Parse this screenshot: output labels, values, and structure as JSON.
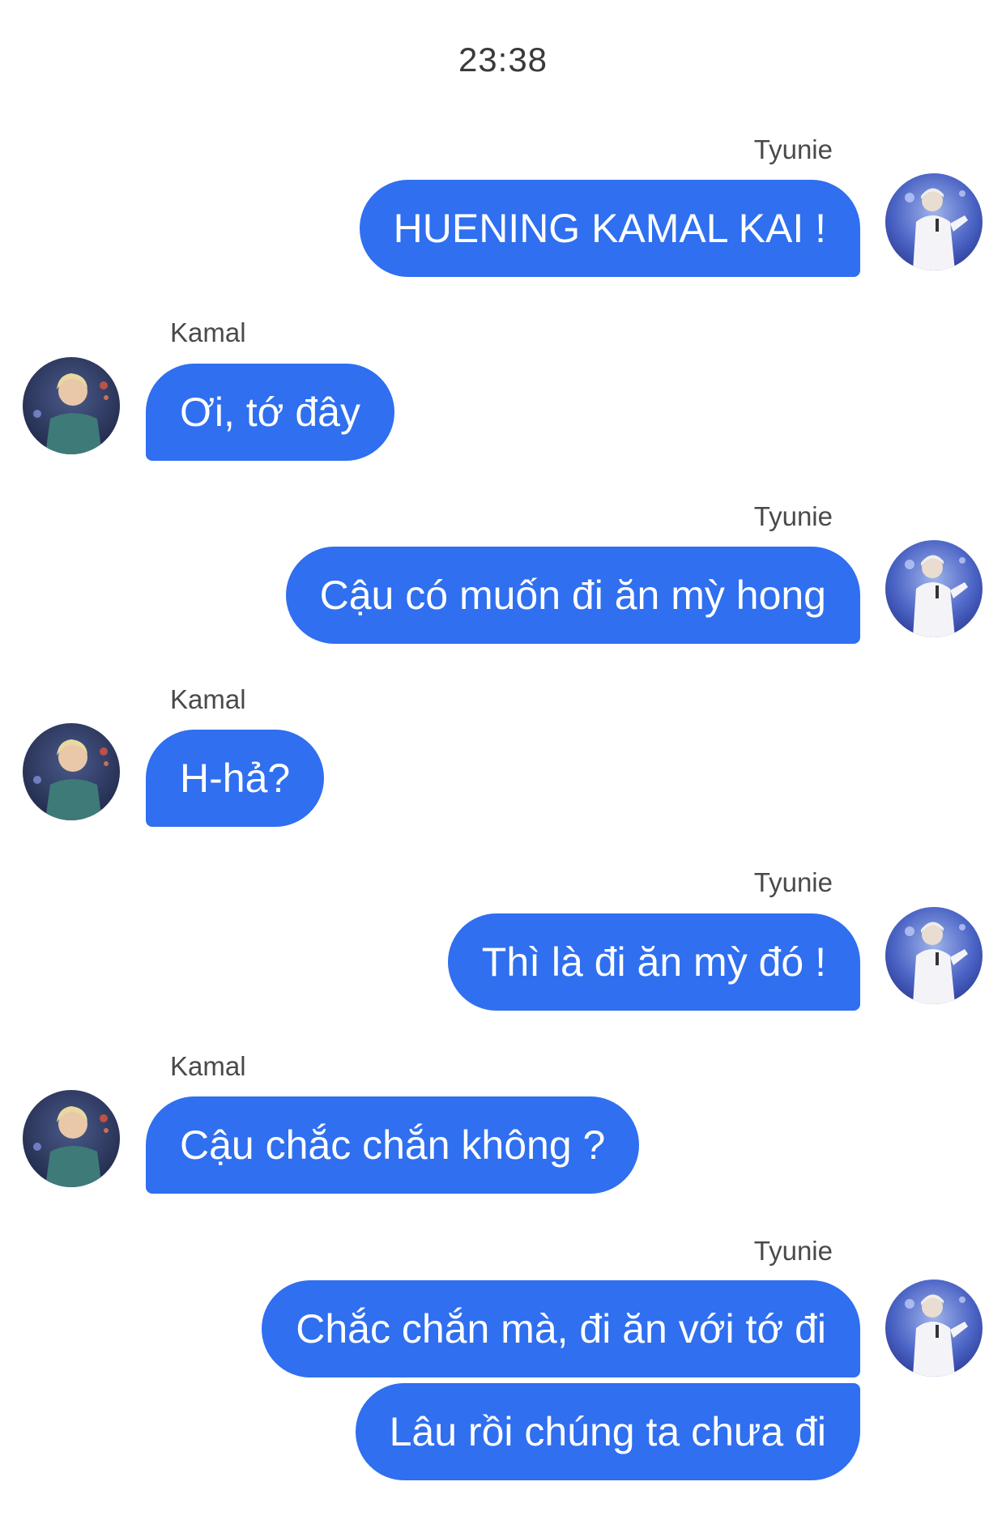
{
  "timestamp": "23:38",
  "avatar_icons": {
    "tyunie": "avatar-tyunie-icon",
    "kamal": "avatar-kamal-icon"
  },
  "colors": {
    "bubble": "#2f6ff0",
    "bubble_text": "#ffffff",
    "name_text": "#4a4a4a",
    "background": "#ffffff"
  },
  "messages": [
    {
      "sender": "Tyunie",
      "side": "right",
      "text": "HUENING KAMAL KAI !"
    },
    {
      "sender": "Kamal",
      "side": "left",
      "text": "Ơi, tớ đây"
    },
    {
      "sender": "Tyunie",
      "side": "right",
      "text": "Cậu có muốn đi ăn mỳ hong"
    },
    {
      "sender": "Kamal",
      "side": "left",
      "text": "H-hả?"
    },
    {
      "sender": "Tyunie",
      "side": "right",
      "text": "Thì là đi ăn mỳ đó !"
    },
    {
      "sender": "Kamal",
      "side": "left",
      "text": "Cậu chắc chắn không ?"
    },
    {
      "sender": "Tyunie",
      "side": "right",
      "text": "Chắc chắn mà, đi ăn với tớ đi"
    },
    {
      "sender": "",
      "side": "right",
      "text": "Lâu rồi chúng ta chưa đi"
    }
  ]
}
